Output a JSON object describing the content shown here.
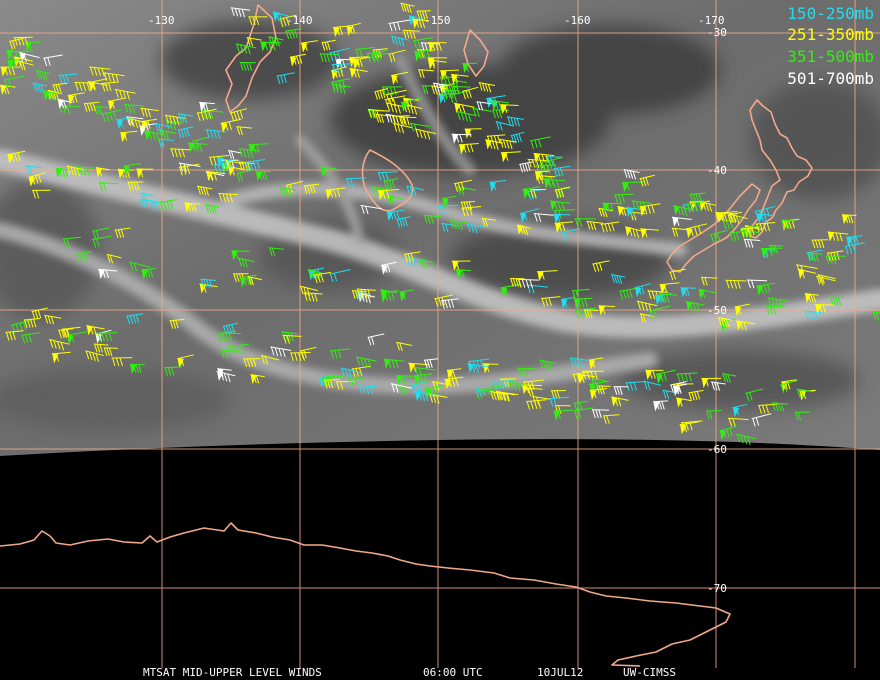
{
  "map": {
    "longitude_labels": [
      "-130",
      "-140",
      "-150",
      "-160",
      "-170"
    ],
    "latitude_labels": [
      "-30",
      "-40",
      "-50",
      "-60",
      "-70"
    ]
  },
  "legend": [
    {
      "label": "150-250mb",
      "color": "#22ddee"
    },
    {
      "label": "251-350mb",
      "color": "#ffff00"
    },
    {
      "label": "351-500mb",
      "color": "#33ee11"
    },
    {
      "label": "501-700mb",
      "color": "#ffffff"
    }
  ],
  "footer": {
    "product": "MTSAT MID-UPPER LEVEL WINDS",
    "time": "06:00 UTC",
    "date": "10JUL12",
    "source": "UW-CIMSS"
  },
  "colors": {
    "grid": "#f2a98a",
    "coastline": "#f2a98a",
    "space": "#000000"
  }
}
